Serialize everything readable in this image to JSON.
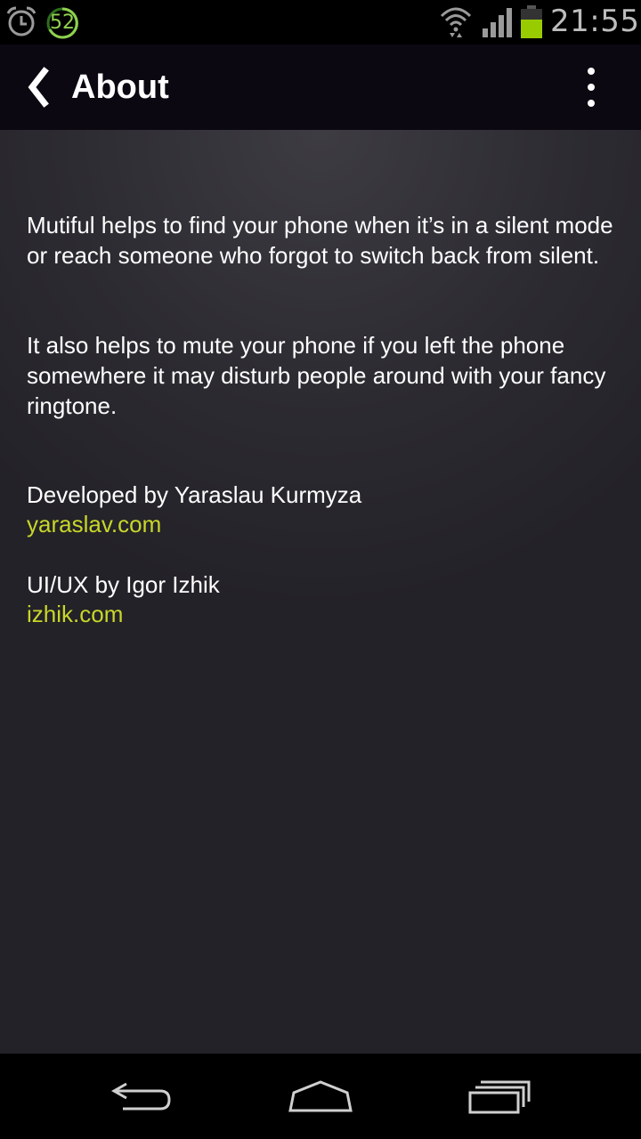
{
  "status_bar": {
    "time": "21:55",
    "badge_number": "52",
    "icons": [
      "alarm-icon",
      "notification-badge-icon",
      "wifi-icon",
      "signal-icon",
      "battery-icon"
    ],
    "battery_color": "#99cc00"
  },
  "action_bar": {
    "title": "About",
    "back_icon": "chevron-left-icon",
    "menu_icon": "overflow-menu-icon"
  },
  "content": {
    "paragraph_1": "Mutiful helps to find your phone when it’s in a silent mode or reach someone who forgot to switch back from silent.",
    "paragraph_2": "It also helps to mute your phone if you left the phone somewhere it may disturb people around with your fancy ringtone.",
    "developer_credit": "Developed by Yaraslau Kurmyza",
    "developer_link": "yaraslav.com",
    "designer_credit": "UI/UX by Igor Izhik",
    "designer_link": "izhik.com"
  },
  "colors": {
    "link": "#c8d62a",
    "action_bar_bg": "#0c0812",
    "content_bg": "#232228"
  },
  "nav_bar": {
    "icons": [
      "back-icon",
      "home-icon",
      "recent-apps-icon"
    ]
  }
}
